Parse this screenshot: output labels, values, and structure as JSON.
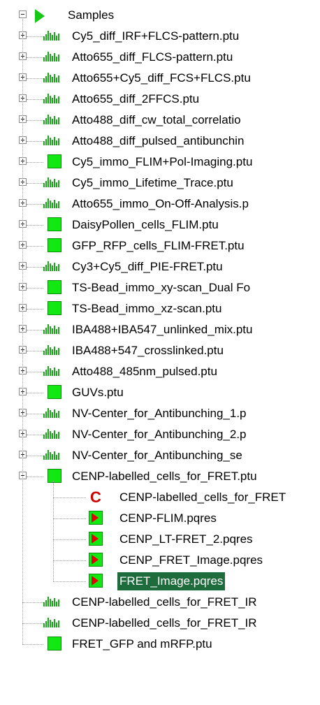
{
  "tree": {
    "root": {
      "label": "Samples",
      "icon": "play-icon",
      "expanded": true
    },
    "items": [
      {
        "label": "Cy5_diff_IRF+FLCS-pattern.ptu",
        "icon": "histogram-icon",
        "expander": "plus"
      },
      {
        "label": "Atto655_diff_FLCS-pattern.ptu",
        "icon": "histogram-icon",
        "expander": "plus"
      },
      {
        "label": "Atto655+Cy5_diff_FCS+FLCS.ptu",
        "icon": "histogram-icon",
        "expander": "plus"
      },
      {
        "label": "Atto655_diff_2FFCS.ptu",
        "icon": "histogram-icon",
        "expander": "plus"
      },
      {
        "label": "Atto488_diff_cw_total_correlatio",
        "icon": "histogram-icon",
        "expander": "plus"
      },
      {
        "label": "Atto488_diff_pulsed_antibunchin",
        "icon": "histogram-icon",
        "expander": "plus"
      },
      {
        "label": "Cy5_immo_FLIM+Pol-Imaging.ptu",
        "icon": "image-square-icon",
        "expander": "plus"
      },
      {
        "label": "Cy5_immo_Lifetime_Trace.ptu",
        "icon": "histogram-icon",
        "expander": "plus"
      },
      {
        "label": "Atto655_immo_On-Off-Analysis.p",
        "icon": "histogram-icon",
        "expander": "plus"
      },
      {
        "label": "DaisyPollen_cells_FLIM.ptu",
        "icon": "image-square-icon",
        "expander": "plus"
      },
      {
        "label": "GFP_RFP_cells_FLIM-FRET.ptu",
        "icon": "image-square-icon",
        "expander": "plus"
      },
      {
        "label": "Cy3+Cy5_diff_PIE-FRET.ptu",
        "icon": "histogram-icon",
        "expander": "plus"
      },
      {
        "label": "TS-Bead_immo_xy-scan_Dual Fo",
        "icon": "image-square-icon",
        "expander": "plus"
      },
      {
        "label": "TS-Bead_immo_xz-scan.ptu",
        "icon": "image-square-icon",
        "expander": "plus"
      },
      {
        "label": "IBA488+IBA547_unlinked_mix.ptu",
        "icon": "histogram-icon",
        "expander": "plus"
      },
      {
        "label": "IBA488+547_crosslinked.ptu",
        "icon": "histogram-icon",
        "expander": "plus"
      },
      {
        "label": "Atto488_485nm_pulsed.ptu",
        "icon": "histogram-icon",
        "expander": "plus"
      },
      {
        "label": "GUVs.ptu",
        "icon": "image-square-icon",
        "expander": "plus"
      },
      {
        "label": "NV-Center_for_Antibunching_1.p",
        "icon": "histogram-icon",
        "expander": "plus"
      },
      {
        "label": "NV-Center_for_Antibunching_2.p",
        "icon": "histogram-icon",
        "expander": "plus"
      },
      {
        "label": "NV-Center_for_Antibunching_se",
        "icon": "histogram-icon",
        "expander": "plus"
      },
      {
        "label": "CENP-labelled_cells_for_FRET.ptu",
        "icon": "image-square-icon",
        "expander": "minus",
        "children": [
          {
            "label": "CENP-labelled_cells_for_FRET",
            "icon": "correlation-c-icon"
          },
          {
            "label": "CENP-FLIM.pqres",
            "icon": "result-play-icon"
          },
          {
            "label": "CENP_LT-FRET_2.pqres",
            "icon": "result-play-icon"
          },
          {
            "label": "CENP_FRET_Image.pqres",
            "icon": "result-play-icon"
          },
          {
            "label": "FRET_Image.pqres",
            "icon": "result-play-icon",
            "selected": true
          }
        ]
      },
      {
        "label": "CENP-labelled_cells_for_FRET_IR",
        "icon": "histogram-icon",
        "expander": "none"
      },
      {
        "label": "CENP-labelled_cells_for_FRET_IR",
        "icon": "histogram-icon",
        "expander": "none"
      },
      {
        "label": "FRET_GFP and mRFP.ptu",
        "icon": "image-square-icon",
        "expander": "none"
      }
    ]
  },
  "colors": {
    "accent_green": "#12e812",
    "play_green": "#14c814",
    "selection_bg": "#1e6b3c",
    "result_red": "#e40000"
  }
}
